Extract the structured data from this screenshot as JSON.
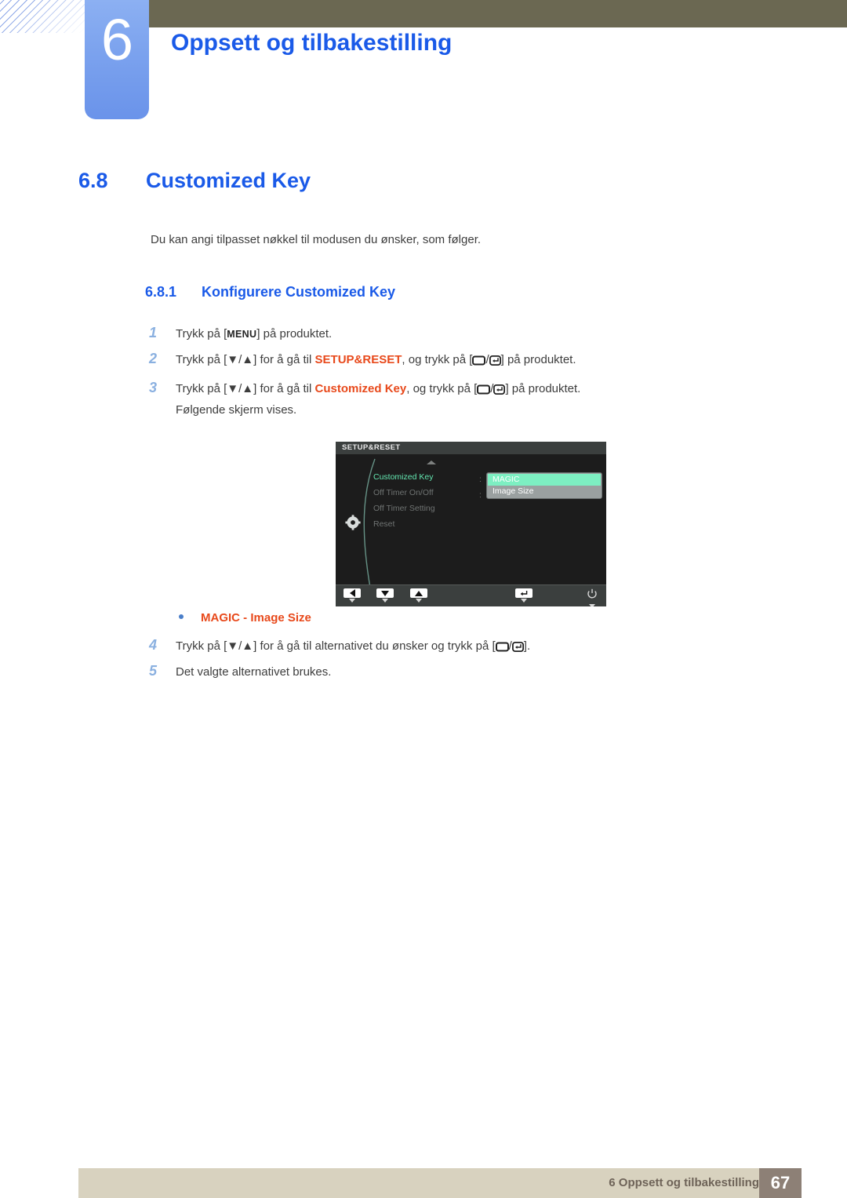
{
  "header": {
    "chapter_number": "6",
    "chapter_title": "Oppsett og tilbakestilling"
  },
  "section": {
    "number": "6.8",
    "title": "Customized Key",
    "intro": "Du kan angi tilpasset nøkkel til modusen du ønsker, som følger."
  },
  "subsection": {
    "number": "6.8.1",
    "title": "Konfigurere Customized Key"
  },
  "steps": [
    {
      "n": "1",
      "parts": [
        {
          "t": "Trykk på [",
          "style": "plain"
        },
        {
          "t": "MENU",
          "style": "kbd"
        },
        {
          "t": "] på produktet.",
          "style": "plain"
        }
      ]
    },
    {
      "n": "2",
      "parts": [
        {
          "t": "Trykk på [▼/▲] for å gå til ",
          "style": "plain"
        },
        {
          "t": "SETUP&RESET",
          "style": "orange"
        },
        {
          "t": ", og trykk på [",
          "style": "plain"
        },
        {
          "t": "display-icon",
          "style": "icon"
        },
        {
          "t": "/",
          "style": "plain"
        },
        {
          "t": "enter-icon",
          "style": "icon"
        },
        {
          "t": "] på produktet.",
          "style": "plain"
        }
      ]
    },
    {
      "n": "3",
      "parts": [
        {
          "t": "Trykk på [▼/▲] for å gå til ",
          "style": "plain"
        },
        {
          "t": "Customized Key",
          "style": "orange"
        },
        {
          "t": ", og trykk på [",
          "style": "plain"
        },
        {
          "t": "display-icon",
          "style": "icon"
        },
        {
          "t": "/",
          "style": "plain"
        },
        {
          "t": "enter-icon",
          "style": "icon"
        },
        {
          "t": "] på produktet.",
          "style": "plain"
        }
      ]
    }
  ],
  "step3_note": "Følgende skjerm vises.",
  "bullet": {
    "left": "MAGIC",
    "separator": " - ",
    "right": "Image Size"
  },
  "step4": {
    "n": "4",
    "prefix": "Trykk på [▼/▲] for å gå til alternativet du ønsker og trykk på [",
    "suffix": "]."
  },
  "step5": {
    "n": "5",
    "text": "Det valgte alternativet brukes."
  },
  "osd": {
    "title": "SETUP&RESET",
    "menu_items": [
      {
        "label": "Customized Key",
        "selected": true
      },
      {
        "label": "Off Timer On/Off",
        "selected": false
      },
      {
        "label": "Off Timer Setting",
        "selected": false
      },
      {
        "label": "Reset",
        "selected": false
      }
    ],
    "values": [
      {
        "label": "MAGIC",
        "highlighted": true
      },
      {
        "label": "Image Size",
        "highlighted": false
      }
    ],
    "colon": ":",
    "buttons": [
      {
        "name": "left-arrow-button"
      },
      {
        "name": "down-arrow-button"
      },
      {
        "name": "up-arrow-button"
      },
      {
        "name": "enter-button"
      },
      {
        "name": "power-button"
      }
    ],
    "colors": {
      "background": "#1c1c1c",
      "title_bar": "#3b3f3e",
      "selected_text": "#63e6b0",
      "highlight": "#7defc2",
      "value_box": "#9aa0a0"
    }
  },
  "footer": {
    "text": "6 Oppsett og tilbakestilling",
    "page": "67"
  },
  "colors": {
    "heading_blue": "#1a5ae8",
    "accent_orange": "#e8491b",
    "olive": "#6b6852",
    "footer_bar": "#d8d2bf",
    "page_box": "#8d8076",
    "chapter_blue": "#7ba2ee"
  }
}
